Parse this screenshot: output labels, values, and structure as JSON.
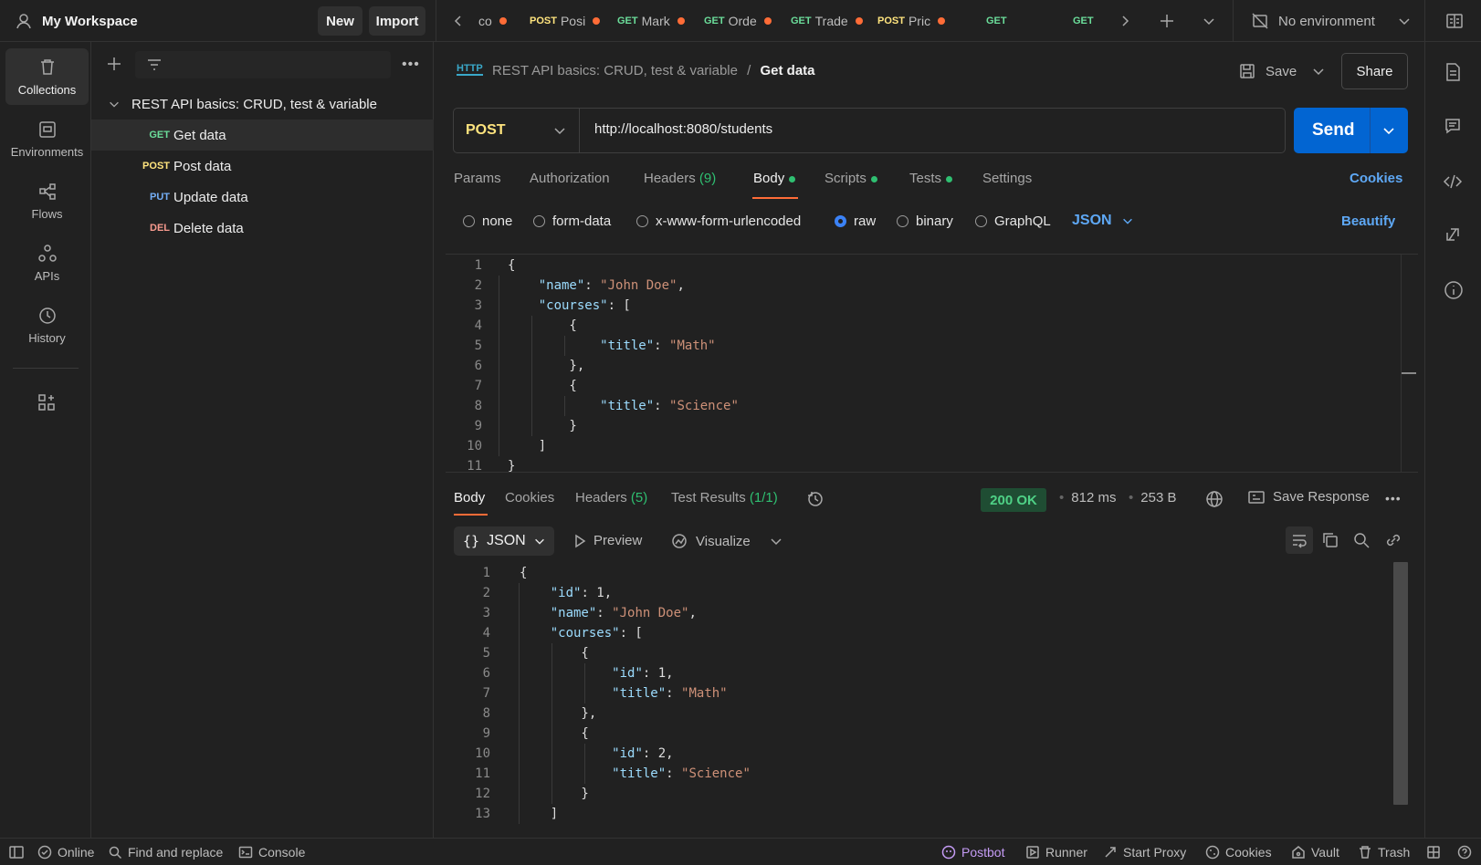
{
  "workspace": {
    "name": "My Workspace",
    "new_label": "New",
    "import_label": "Import"
  },
  "tabs": [
    {
      "method": "",
      "name": "co",
      "dirty": true
    },
    {
      "method": "POST",
      "name": "Posi",
      "dirty": true
    },
    {
      "method": "GET",
      "name": "Mark",
      "dirty": true
    },
    {
      "method": "GET",
      "name": "Orde",
      "dirty": true
    },
    {
      "method": "GET",
      "name": "Trade",
      "dirty": true
    },
    {
      "method": "POST",
      "name": "Pric",
      "dirty": true
    },
    {
      "method": "GET",
      "name": "",
      "dirty": false
    },
    {
      "method": "GET",
      "name": "",
      "dirty": false
    }
  ],
  "environment": {
    "label": "No environment"
  },
  "rail": [
    {
      "label": "Collections",
      "icon": "trash-bin-icon",
      "active": true
    },
    {
      "label": "Environments",
      "icon": "environment-icon",
      "active": false
    },
    {
      "label": "Flows",
      "icon": "flows-icon",
      "active": false
    },
    {
      "label": "APIs",
      "icon": "apis-icon",
      "active": false
    },
    {
      "label": "History",
      "icon": "history-icon",
      "active": false
    }
  ],
  "sidebar": {
    "collection": "REST API basics: CRUD, test & variable",
    "requests": [
      {
        "method": "GET",
        "name": "Get data",
        "selected": true
      },
      {
        "method": "POST",
        "name": "Post data",
        "selected": false
      },
      {
        "method": "PUT",
        "name": "Update data",
        "selected": false
      },
      {
        "method": "DEL",
        "name": "Delete data",
        "selected": false
      }
    ]
  },
  "request": {
    "http_badge": "HTTP",
    "breadcrumb_parent": "REST API basics: CRUD, test & variable",
    "breadcrumb_sep": "/",
    "title": "Get data",
    "save_label": "Save",
    "share_label": "Share",
    "method": "POST",
    "url": "http://localhost:8080/students",
    "send_label": "Send",
    "tabs": {
      "params": "Params",
      "authorization": "Authorization",
      "headers": "Headers",
      "headers_count": "(9)",
      "body": "Body",
      "scripts": "Scripts",
      "tests": "Tests",
      "settings": "Settings"
    },
    "cookies_label": "Cookies",
    "body_types": [
      "none",
      "form-data",
      "x-www-form-urlencoded",
      "raw",
      "binary",
      "GraphQL"
    ],
    "body_type_selected": "raw",
    "format": "JSON",
    "beautify_label": "Beautify",
    "code_lines": [
      "1",
      "2",
      "3",
      "4",
      "5",
      "6",
      "7",
      "8",
      "9",
      "10",
      "11"
    ]
  },
  "response": {
    "tabs": {
      "body": "Body",
      "cookies": "Cookies",
      "headers": "Headers",
      "headers_count": "(5)",
      "test_results": "Test Results",
      "test_count": "(1/1)"
    },
    "status": "200 OK",
    "time": "812 ms",
    "size": "253 B",
    "save_response_label": "Save Response",
    "format": "JSON",
    "preview_label": "Preview",
    "visualize_label": "Visualize",
    "code_lines": [
      "1",
      "2",
      "3",
      "4",
      "5",
      "6",
      "7",
      "8",
      "9",
      "10",
      "11",
      "12",
      "13"
    ]
  },
  "statusbar": {
    "online": "Online",
    "find_replace": "Find and replace",
    "console": "Console",
    "postbot": "Postbot",
    "runner": "Runner",
    "start_proxy": "Start Proxy",
    "cookies": "Cookies",
    "vault": "Vault",
    "trash": "Trash"
  },
  "colors": {
    "accent_blue": "#0265d2",
    "orange": "#ff6c37",
    "green": "#2fbf71",
    "status_ok_bg": "#1f4d33"
  }
}
